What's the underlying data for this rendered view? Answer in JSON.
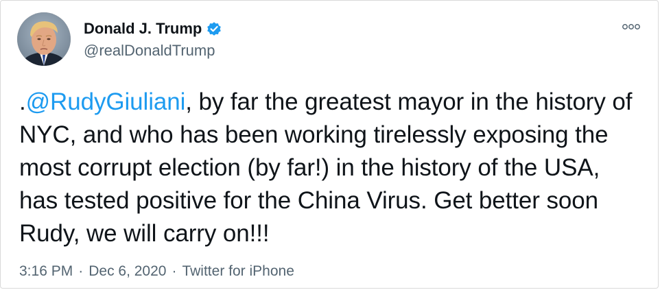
{
  "author": {
    "display_name": "Donald J. Trump",
    "handle": "@realDonaldTrump",
    "verified": true,
    "avatar_icon": "profile-photo"
  },
  "tweet": {
    "text_prefix": ".",
    "mention": "@RudyGiuliani",
    "text_body": ", by far the greatest mayor in the history of NYC, and who has been working tirelessly exposing the most corrupt election (by far!) in the history of the USA, has tested positive for the China Virus. Get better soon Rudy, we will carry on!!!"
  },
  "meta": {
    "time": "3:16 PM",
    "separator": "·",
    "date": "Dec 6, 2020",
    "source": "Twitter for iPhone"
  },
  "colors": {
    "accent": "#1d9bf0",
    "text": "#0f1419",
    "secondary": "#536471",
    "border": "#d9d9d9"
  },
  "icons": {
    "verified": "verified-badge-icon",
    "more": "more-options-icon"
  }
}
